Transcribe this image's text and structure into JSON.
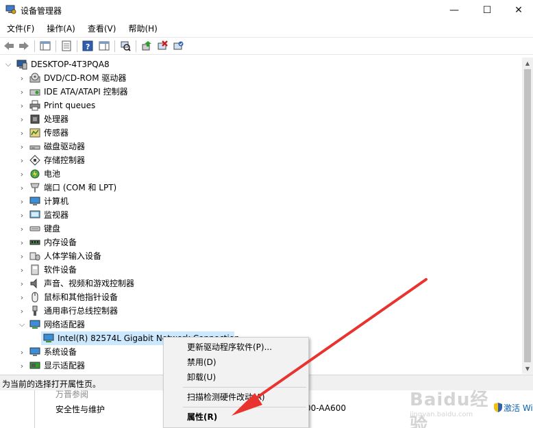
{
  "window": {
    "title": "设备管理器",
    "controls": {
      "minimize": "—",
      "maximize": "☐",
      "close": "✕"
    }
  },
  "menu": [
    "文件(F)",
    "操作(A)",
    "查看(V)",
    "帮助(H)"
  ],
  "tree": {
    "root": "DESKTOP-4T3PQA8",
    "categories": [
      "DVD/CD-ROM 驱动器",
      "IDE ATA/ATAPI 控制器",
      "Print queues",
      "处理器",
      "传感器",
      "磁盘驱动器",
      "存储控制器",
      "电池",
      "端口 (COM 和 LPT)",
      "计算机",
      "监视器",
      "键盘",
      "内存设备",
      "人体学输入设备",
      "软件设备",
      "声音、视频和游戏控制器",
      "鼠标和其他指针设备",
      "通用串行总线控制器",
      "网络适配器"
    ],
    "selected_child": "Intel(R) 82574L Gigabit Network Connection",
    "after": [
      "系统设备",
      "显示适配器"
    ]
  },
  "status": "为当前的选择打开属性页。",
  "context_menu": {
    "update_driver": "更新驱动程序软件(P)...",
    "disable": "禁用(D)",
    "uninstall": "卸载(U)",
    "scan": "扫描检测硬件改动(A)",
    "properties": "属性(R)"
  },
  "background_window": {
    "cut_text": "万晋参阅",
    "security": "安全性与维护",
    "code": "00-AA600",
    "activate": "激活 Wi"
  },
  "watermark": {
    "brand": "Baidu经验",
    "url": "jingyan.baidu.com"
  },
  "colors": {
    "selection": "#cce8ff",
    "arrow": "#e8332f",
    "menu_bg": "#f2f2f2"
  }
}
